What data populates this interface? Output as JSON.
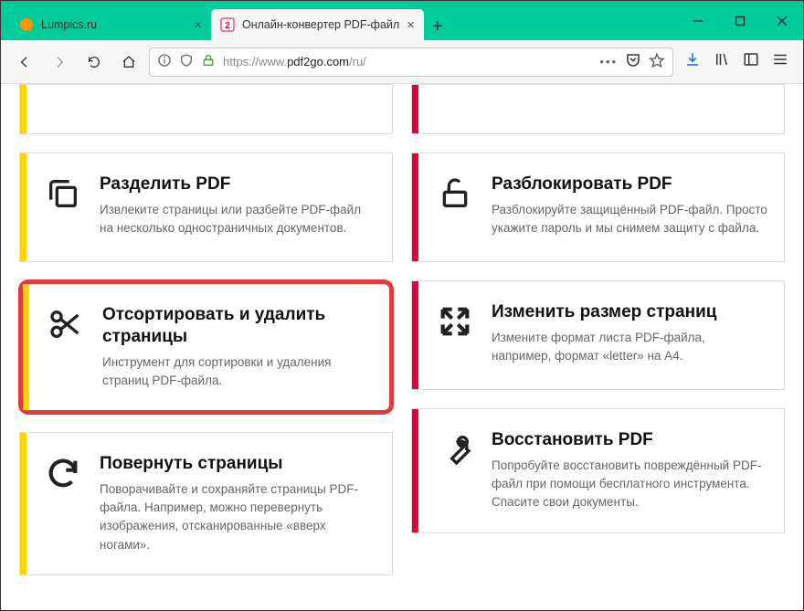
{
  "window": {
    "tabs": [
      {
        "label": "Lumpics.ru",
        "active": false
      },
      {
        "label": "Онлайн-конвертер PDF-файл",
        "active": true
      }
    ]
  },
  "nav": {
    "url_prefix": "https://www.",
    "url_host": "pdf2go.com",
    "url_path": "/ru/"
  },
  "cards": {
    "split": {
      "title": "Разделить PDF",
      "desc": "Извлеките страницы или разбейте PDF-файл на несколько одностраничных документов."
    },
    "unlock": {
      "title": "Разблокировать PDF",
      "desc": "Разблокируйте защищённый PDF-файл. Просто укажите пароль и мы снимем защиту с файла."
    },
    "sort": {
      "title": "Отсортировать и удалить страницы",
      "desc": "Инструмент для сортировки и удаления страниц PDF-файла."
    },
    "resize": {
      "title": "Изменить размер страниц",
      "desc": "Измените формат листа PDF-файла, например, формат «letter» на A4."
    },
    "rotate": {
      "title": "Повернуть страницы",
      "desc": "Поворачивайте и сохраняйте страницы PDF-файла. Например, можно перевернуть изображения, отсканированные «вверх ногами»."
    },
    "repair": {
      "title": "Восстановить PDF",
      "desc": "Попробуйте восстановить повреждённый PDF-файл при помощи бесплатного инструмента. Спасите свои документы."
    }
  }
}
